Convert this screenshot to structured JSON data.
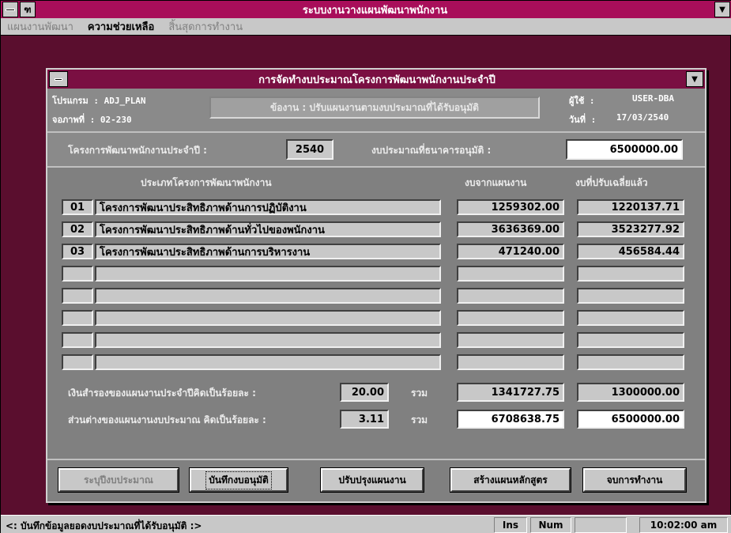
{
  "app": {
    "title": "ระบบงานวางแผนพัฒนาพนักงาน",
    "icon_text": "ฑ"
  },
  "menu": {
    "items": [
      {
        "label": "แผนงานพัฒนา",
        "active": false
      },
      {
        "label": "ความช่วยเหลือ",
        "active": true
      },
      {
        "label": "สิ้นสุดการทำงาน",
        "active": false
      }
    ]
  },
  "dialog": {
    "title": "การจัดทำงบประมาณโครงการพัฒนาพนักงานประจำปี",
    "program_label": "โปรแกรม : ADJ_PLAN",
    "screen_label": "จอภาพที่ : 02-230",
    "message": "ข้องาน : ปรับแผนงานตามงบประมาณที่ได้รับอนุมัติ",
    "user_label": "ผู้ใช้ :",
    "user_value": "USER-DBA",
    "date_label": "วันที่ :",
    "date_value": "17/03/2540",
    "year_label": "โครงการพัฒนาพนักงานประจำปี :",
    "year_value": "2540",
    "approved_label": "งบประมาณที่ธนาคารอนุมัติ :",
    "approved_value": "6500000.00",
    "col_type": "ประเภทโครงการพัฒนาพนักงาน",
    "col_plan": "งบจากแผนงาน",
    "col_adjusted": "งบที่ปรับเฉลี่ยแล้ว",
    "rows": [
      {
        "code": "01",
        "name": "โครงการพัฒนาประสิทธิภาพด้านการปฏิบัติงาน",
        "plan": "1259302.00",
        "adjusted": "1220137.71"
      },
      {
        "code": "02",
        "name": "โครงการพัฒนาประสิทธิภาพด้านทั่วไปของพนักงาน",
        "plan": "3636369.00",
        "adjusted": "3523277.92"
      },
      {
        "code": "03",
        "name": "โครงการพัฒนาประสิทธิภาพด้านการบริหารงาน",
        "plan": "471240.00",
        "adjusted": "456584.44"
      },
      {
        "code": "",
        "name": "",
        "plan": "",
        "adjusted": ""
      },
      {
        "code": "",
        "name": "",
        "plan": "",
        "adjusted": ""
      },
      {
        "code": "",
        "name": "",
        "plan": "",
        "adjusted": ""
      },
      {
        "code": "",
        "name": "",
        "plan": "",
        "adjusted": ""
      },
      {
        "code": "",
        "name": "",
        "plan": "",
        "adjusted": ""
      }
    ],
    "reserve_label": "เงินสำรองของแผนงานประจำปีคิดเป็นร้อยละ :",
    "reserve_pct": "20.00",
    "total_label": "รวม",
    "reserve_plan": "1341727.75",
    "reserve_adjusted": "1300000.00",
    "diff_label": "ส่วนต่างของแผนงานงบประมาณ คิดเป็นร้อยละ :",
    "diff_pct": "3.11",
    "total_plan": "6708638.75",
    "total_adjusted": "6500000.00"
  },
  "buttons": {
    "budget": "ระบุปีงบประมาณ",
    "save": "บันทึกงบอนุมัติ",
    "adjust": "ปรับปรุงแผนงาน",
    "course": "สร้างแผนหลักสูตร",
    "exit": "จบการทำงาน"
  },
  "status": {
    "message": "<: บันทึกข้อมูลยอดงบประมาณที่ได้รับอนุมัติ :>",
    "ins": "Ins",
    "num": "Num",
    "time": "10:02:00 am"
  }
}
